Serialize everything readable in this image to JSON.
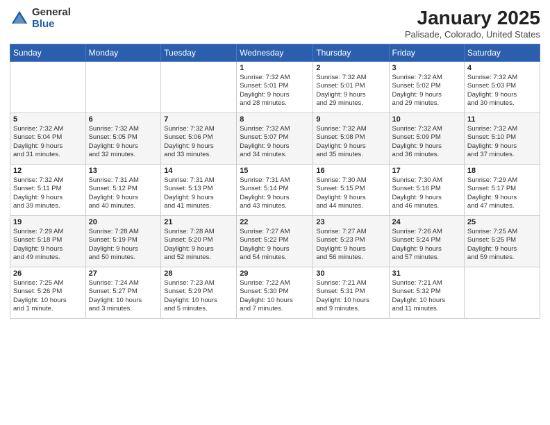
{
  "logo": {
    "general": "General",
    "blue": "Blue"
  },
  "title": "January 2025",
  "location": "Palisade, Colorado, United States",
  "days_of_week": [
    "Sunday",
    "Monday",
    "Tuesday",
    "Wednesday",
    "Thursday",
    "Friday",
    "Saturday"
  ],
  "weeks": [
    [
      {
        "day": "",
        "content": ""
      },
      {
        "day": "",
        "content": ""
      },
      {
        "day": "",
        "content": ""
      },
      {
        "day": "1",
        "content": "Sunrise: 7:32 AM\nSunset: 5:01 PM\nDaylight: 9 hours\nand 28 minutes."
      },
      {
        "day": "2",
        "content": "Sunrise: 7:32 AM\nSunset: 5:01 PM\nDaylight: 9 hours\nand 29 minutes."
      },
      {
        "day": "3",
        "content": "Sunrise: 7:32 AM\nSunset: 5:02 PM\nDaylight: 9 hours\nand 29 minutes."
      },
      {
        "day": "4",
        "content": "Sunrise: 7:32 AM\nSunset: 5:03 PM\nDaylight: 9 hours\nand 30 minutes."
      }
    ],
    [
      {
        "day": "5",
        "content": "Sunrise: 7:32 AM\nSunset: 5:04 PM\nDaylight: 9 hours\nand 31 minutes."
      },
      {
        "day": "6",
        "content": "Sunrise: 7:32 AM\nSunset: 5:05 PM\nDaylight: 9 hours\nand 32 minutes."
      },
      {
        "day": "7",
        "content": "Sunrise: 7:32 AM\nSunset: 5:06 PM\nDaylight: 9 hours\nand 33 minutes."
      },
      {
        "day": "8",
        "content": "Sunrise: 7:32 AM\nSunset: 5:07 PM\nDaylight: 9 hours\nand 34 minutes."
      },
      {
        "day": "9",
        "content": "Sunrise: 7:32 AM\nSunset: 5:08 PM\nDaylight: 9 hours\nand 35 minutes."
      },
      {
        "day": "10",
        "content": "Sunrise: 7:32 AM\nSunset: 5:09 PM\nDaylight: 9 hours\nand 36 minutes."
      },
      {
        "day": "11",
        "content": "Sunrise: 7:32 AM\nSunset: 5:10 PM\nDaylight: 9 hours\nand 37 minutes."
      }
    ],
    [
      {
        "day": "12",
        "content": "Sunrise: 7:32 AM\nSunset: 5:11 PM\nDaylight: 9 hours\nand 39 minutes."
      },
      {
        "day": "13",
        "content": "Sunrise: 7:31 AM\nSunset: 5:12 PM\nDaylight: 9 hours\nand 40 minutes."
      },
      {
        "day": "14",
        "content": "Sunrise: 7:31 AM\nSunset: 5:13 PM\nDaylight: 9 hours\nand 41 minutes."
      },
      {
        "day": "15",
        "content": "Sunrise: 7:31 AM\nSunset: 5:14 PM\nDaylight: 9 hours\nand 43 minutes."
      },
      {
        "day": "16",
        "content": "Sunrise: 7:30 AM\nSunset: 5:15 PM\nDaylight: 9 hours\nand 44 minutes."
      },
      {
        "day": "17",
        "content": "Sunrise: 7:30 AM\nSunset: 5:16 PM\nDaylight: 9 hours\nand 46 minutes."
      },
      {
        "day": "18",
        "content": "Sunrise: 7:29 AM\nSunset: 5:17 PM\nDaylight: 9 hours\nand 47 minutes."
      }
    ],
    [
      {
        "day": "19",
        "content": "Sunrise: 7:29 AM\nSunset: 5:18 PM\nDaylight: 9 hours\nand 49 minutes."
      },
      {
        "day": "20",
        "content": "Sunrise: 7:28 AM\nSunset: 5:19 PM\nDaylight: 9 hours\nand 50 minutes."
      },
      {
        "day": "21",
        "content": "Sunrise: 7:28 AM\nSunset: 5:20 PM\nDaylight: 9 hours\nand 52 minutes."
      },
      {
        "day": "22",
        "content": "Sunrise: 7:27 AM\nSunset: 5:22 PM\nDaylight: 9 hours\nand 54 minutes."
      },
      {
        "day": "23",
        "content": "Sunrise: 7:27 AM\nSunset: 5:23 PM\nDaylight: 9 hours\nand 56 minutes."
      },
      {
        "day": "24",
        "content": "Sunrise: 7:26 AM\nSunset: 5:24 PM\nDaylight: 9 hours\nand 57 minutes."
      },
      {
        "day": "25",
        "content": "Sunrise: 7:25 AM\nSunset: 5:25 PM\nDaylight: 9 hours\nand 59 minutes."
      }
    ],
    [
      {
        "day": "26",
        "content": "Sunrise: 7:25 AM\nSunset: 5:26 PM\nDaylight: 10 hours\nand 1 minute."
      },
      {
        "day": "27",
        "content": "Sunrise: 7:24 AM\nSunset: 5:27 PM\nDaylight: 10 hours\nand 3 minutes."
      },
      {
        "day": "28",
        "content": "Sunrise: 7:23 AM\nSunset: 5:29 PM\nDaylight: 10 hours\nand 5 minutes."
      },
      {
        "day": "29",
        "content": "Sunrise: 7:22 AM\nSunset: 5:30 PM\nDaylight: 10 hours\nand 7 minutes."
      },
      {
        "day": "30",
        "content": "Sunrise: 7:21 AM\nSunset: 5:31 PM\nDaylight: 10 hours\nand 9 minutes."
      },
      {
        "day": "31",
        "content": "Sunrise: 7:21 AM\nSunset: 5:32 PM\nDaylight: 10 hours\nand 11 minutes."
      },
      {
        "day": "",
        "content": ""
      }
    ]
  ]
}
